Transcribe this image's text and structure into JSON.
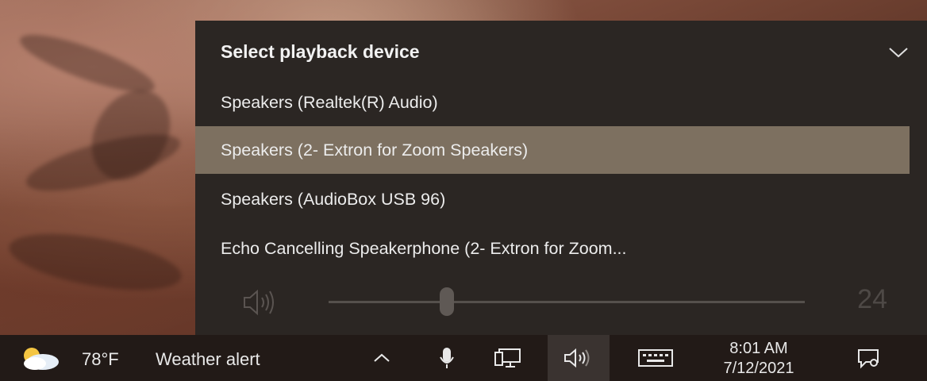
{
  "flyout": {
    "title": "Select playback device",
    "devices": [
      {
        "label": "Speakers (Realtek(R) Audio)",
        "selected": false
      },
      {
        "label": "Speakers (2- Extron for Zoom Speakers)",
        "selected": true
      },
      {
        "label": "Speakers (AudioBox USB 96)",
        "selected": false
      },
      {
        "label": "Echo Cancelling Speakerphone (2- Extron for Zoom...",
        "selected": false
      }
    ],
    "volume": {
      "value": "24",
      "level_percent": 24
    }
  },
  "taskbar": {
    "temperature": "78°F",
    "weather_alert": "Weather alert",
    "time": "8:01 AM",
    "date": "7/12/2021"
  },
  "icons": {
    "weather": "partly-cloudy-icon",
    "tray_overflow": "chevron-up-icon",
    "microphone": "microphone-icon",
    "network": "network-icon",
    "volume": "speaker-icon",
    "keyboard": "keyboard-icon",
    "notifications": "notification-icon"
  },
  "colors": {
    "flyout_bg": "#2b2623",
    "selected_bg": "#7d7060",
    "taskbar_bg": "#221a17"
  }
}
